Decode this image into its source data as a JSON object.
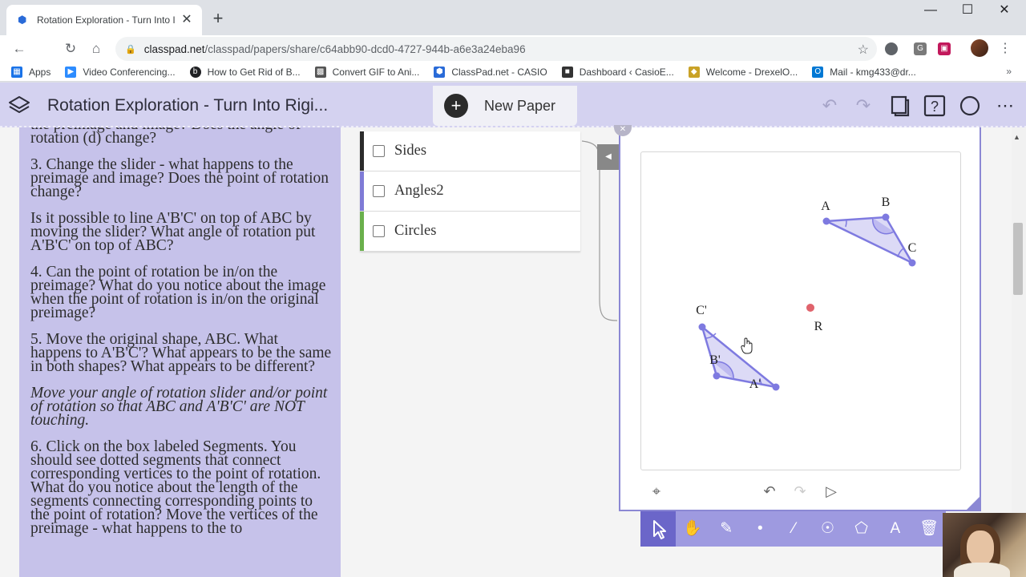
{
  "browser": {
    "tab_title": "Rotation Exploration - Turn Into I",
    "tab_close": "✕",
    "new_tab": "+",
    "url_host": "classpad.net",
    "url_path": "/classpad/papers/share/c64abb90-dcd0-4727-944b-a6e3a24eba96",
    "bookmarks": [
      {
        "label": "Apps",
        "icon": "apps-grid-icon",
        "color": "#1a73e8"
      },
      {
        "label": "Video Conferencing...",
        "icon": "zoom-icon",
        "color": "#2d8cff"
      },
      {
        "label": "How to Get Rid of B...",
        "icon": "dark-circle-icon",
        "color": "#202124"
      },
      {
        "label": "Convert GIF to Ani...",
        "icon": "convert-icon",
        "color": "#555555"
      },
      {
        "label": "ClassPad.net - CASIO",
        "icon": "classpad-icon",
        "color": "#2a6bd8"
      },
      {
        "label": "Dashboard ‹ CasioE...",
        "icon": "casio-dashboard-icon",
        "color": "#333333"
      },
      {
        "label": "Welcome - DrexelO...",
        "icon": "drexel-icon",
        "color": "#c9a227"
      },
      {
        "label": "Mail - kmg433@dr...",
        "icon": "outlook-icon",
        "color": "#0078d4"
      }
    ],
    "bookmarks_more": "»"
  },
  "header": {
    "title": "Rotation Exploration - Turn Into Rigi...",
    "new_paper": "New Paper",
    "new_paper_plus": "+"
  },
  "textcard": {
    "paragraphs": [
      {
        "text": "the preimage and image? Does the angle of rotation (d) change?",
        "italic": false
      },
      {
        "text": "3. Change the slider - what happens to the preimage and image? Does the point of rotation change?",
        "italic": false
      },
      {
        "text": "Is it possible to line A'B'C' on top of ABC by moving the slider? What angle of rotation put A'B'C' on top of ABC?",
        "italic": false
      },
      {
        "text": "4. Can the point of rotation be in/on the preimage? What do you notice about the image when the point of rotation is in/on the original preimage?",
        "italic": false
      },
      {
        "text": "5. Move the original shape, ABC. What happens to A'B'C'? What appears to be the same in both shapes? What appears to be different?",
        "italic": false
      },
      {
        "text": "Move your angle of rotation slider and/or point of rotation so that ABC and A'B'C' are NOT touching.",
        "italic": true
      },
      {
        "text": "6. Click on the box labeled Segments. You should see dotted segments that connect corresponding vertices to the point of rotation.  What do you notice about the length of the segments connecting corresponding points to the point of rotation? Move the vertices of the preimage - what happens to the to",
        "italic": false
      }
    ]
  },
  "checklist": [
    {
      "label": "Sides",
      "checked": false,
      "color": "#2b2b2b"
    },
    {
      "label": "Angles2",
      "checked": false,
      "color": "#7f7bd6"
    },
    {
      "label": "Circles",
      "checked": false,
      "color": "#6ab04c"
    }
  ],
  "geometry": {
    "labels": {
      "A": "A",
      "B": "B",
      "C": "C",
      "A1": "A'",
      "B1": "B'",
      "C1": "C'",
      "R": "R"
    },
    "colors": {
      "shape": "#7e7ae0",
      "fill": "#dcdaf6",
      "point_r": "#e0636c"
    }
  },
  "bottom_tools": [
    "select-arrow-icon",
    "hand-pan-icon",
    "pen-icon",
    "point-icon",
    "line-icon",
    "circle-tool-icon",
    "polygon-icon",
    "text-tool-icon",
    "trash-icon"
  ]
}
